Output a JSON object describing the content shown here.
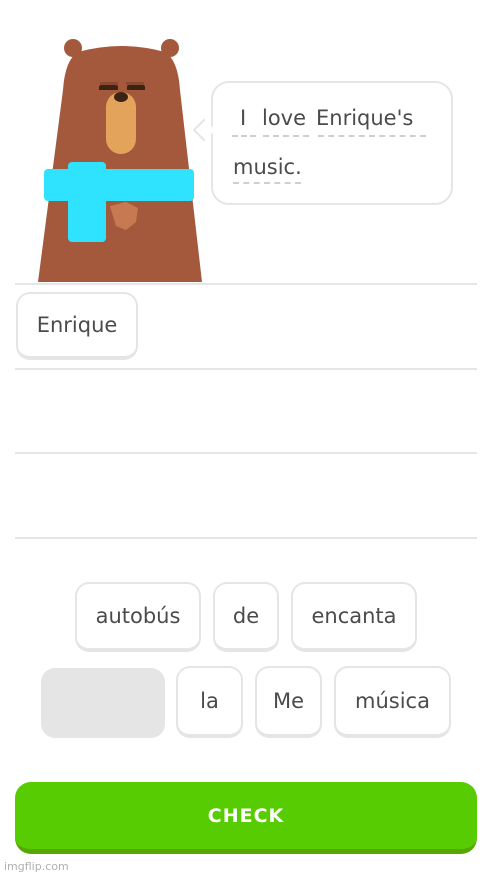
{
  "prompt": {
    "words": [
      "I",
      "love",
      "Enrique's",
      "music."
    ]
  },
  "answer": {
    "selected_words": [
      "Enrique"
    ]
  },
  "word_bank": {
    "row1": [
      "autobús",
      "de",
      "encanta"
    ],
    "row2": [
      "la",
      "Me",
      "música"
    ]
  },
  "actions": {
    "check_label": "CHECK"
  },
  "watermark": "imgflip.com",
  "colors": {
    "character_brown": "#A4593C",
    "character_tie": "#2FE3FF",
    "check_green": "#58CC02",
    "border_gray": "#E5E5E5"
  }
}
